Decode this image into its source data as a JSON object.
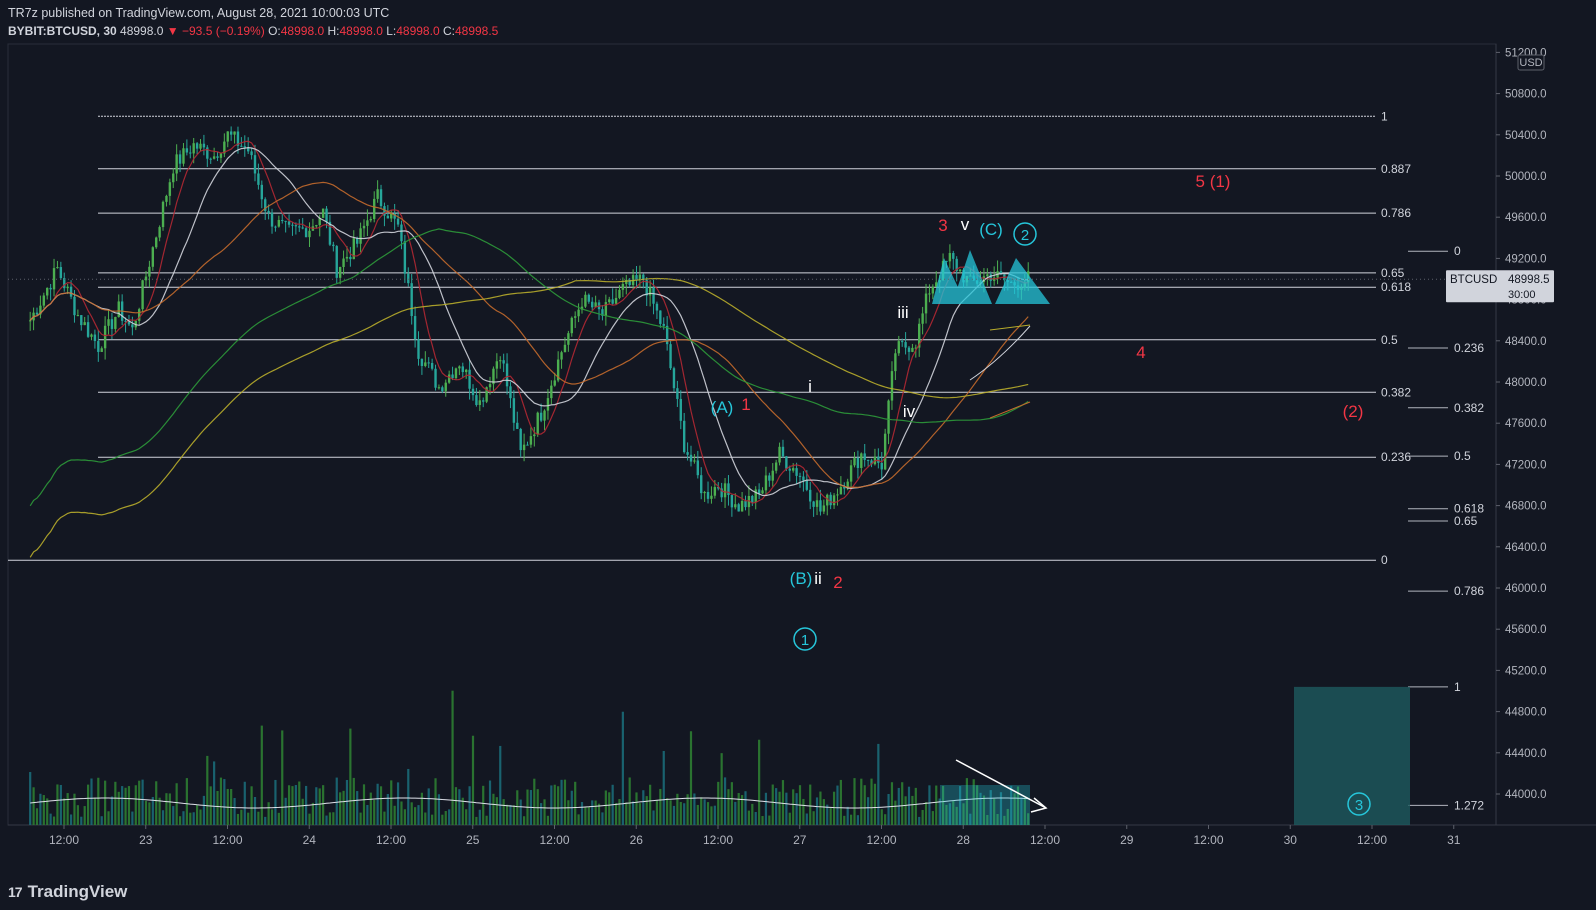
{
  "header": {
    "publisher": "TR7z published on TradingView.com, August 28, 2021 10:00:03 UTC",
    "symbol": "BYBIT:BTCUSD, 30",
    "last": "48998.0",
    "change": "−93.5 (−0.19%)",
    "o_label": "O:",
    "o": "48998.0",
    "h_label": "H:",
    "h": "48998.0",
    "l_label": "L:",
    "l": "48998.0",
    "c_label": "C:",
    "c": "48998.5"
  },
  "footer": {
    "brand": "TradingView",
    "logo": "17"
  },
  "colors": {
    "bg": "#131722",
    "grid": "#1e222d",
    "text": "#b2b5be",
    "up": "#4caf50",
    "down": "#26a69a",
    "red": "#f23645",
    "cyan": "#26c6da",
    "white": "#ffffff"
  },
  "chart_data": {
    "type": "candlestick",
    "symbol": "BTCUSD",
    "currency": "USD",
    "price_label": "48998.5",
    "price_sublabel": "30:00",
    "y_ticks": [
      51200,
      50800,
      50400,
      50000,
      49600,
      49200,
      48800,
      48400,
      48000,
      47600,
      47200,
      46800,
      46400,
      46000,
      45600,
      45200,
      44800,
      44400,
      44000
    ],
    "y_tick_labels": [
      "51200.0",
      "50800.0",
      "50400.0",
      "50000.0",
      "49600.0",
      "49200.0",
      "48800.0",
      "48400.0",
      "48000.0",
      "47600.0",
      "47200.0",
      "46800.0",
      "46400.0",
      "46000.0",
      "45600.0",
      "45200.0",
      "44800.0",
      "44400.0",
      "44000.0"
    ],
    "ylim": [
      43700,
      51250
    ],
    "x_ticks": [
      "12:00",
      "23",
      "12:00",
      "24",
      "12:00",
      "25",
      "12:00",
      "26",
      "12:00",
      "27",
      "12:00",
      "28",
      "12:00",
      "29",
      "12:00",
      "30",
      "12:00",
      "31"
    ],
    "price_path": [
      [
        "Aug 22 07:00",
        48600
      ],
      [
        "Aug 22 11:00",
        49100
      ],
      [
        "Aug 22 14:00",
        48650
      ],
      [
        "Aug 22 17:00",
        48350
      ],
      [
        "Aug 22 20:00",
        48700
      ],
      [
        "Aug 22 22:00",
        48500
      ],
      [
        "Aug 23 01:00",
        49300
      ],
      [
        "Aug 23 04:00",
        50100
      ],
      [
        "Aug 23 07:00",
        50300
      ],
      [
        "Aug 23 10:00",
        50200
      ],
      [
        "Aug 23 12:00",
        50400
      ],
      [
        "Aug 23 15:00",
        50250
      ],
      [
        "Aug 23 18:00",
        49600
      ],
      [
        "Aug 23 21:00",
        49450
      ],
      [
        "Aug 24 00:00",
        49500
      ],
      [
        "Aug 24 02:00",
        49650
      ],
      [
        "Aug 24 04:00",
        49100
      ],
      [
        "Aug 24 07:00",
        49350
      ],
      [
        "Aug 24 10:00",
        49800
      ],
      [
        "Aug 24 13:00",
        49500
      ],
      [
        "Aug 24 16:00",
        48300
      ],
      [
        "Aug 24 19:00",
        47950
      ],
      [
        "Aug 24 22:00",
        48200
      ],
      [
        "Aug 25 01:00",
        47800
      ],
      [
        "Aug 25 04:00",
        48300
      ],
      [
        "Aug 25 07:00",
        47300
      ],
      [
        "Aug 25 10:00",
        47700
      ],
      [
        "Aug 25 13:00",
        48300
      ],
      [
        "Aug 25 16:00",
        48800
      ],
      [
        "Aug 25 19:00",
        48650
      ],
      [
        "Aug 25 22:00",
        48900
      ],
      [
        "Aug 26 01:00",
        49000
      ],
      [
        "Aug 26 04:00",
        48500
      ],
      [
        "Aug 26 07:00",
        47400
      ],
      [
        "Aug 26 10:00",
        46900
      ],
      [
        "Aug 26 12:00",
        47000
      ],
      [
        "Aug 26 15:00",
        46800
      ],
      [
        "Aug 26 18:00",
        46900
      ],
      [
        "Aug 26 21:00",
        47300
      ],
      [
        "Aug 27 00:00",
        47100
      ],
      [
        "Aug 27 03:00",
        46750
      ],
      [
        "Aug 27 06:00",
        47000
      ],
      [
        "Aug 27 09:00",
        47300
      ],
      [
        "Aug 27 12:00",
        47200
      ],
      [
        "Aug 27 14:00",
        48300
      ],
      [
        "Aug 27 17:00",
        48400
      ],
      [
        "Aug 27 19:00",
        48900
      ],
      [
        "Aug 27 22:00",
        49200
      ],
      [
        "Aug 28 01:00",
        48950
      ],
      [
        "Aug 28 04:00",
        49050
      ],
      [
        "Aug 28 07:00",
        48950
      ],
      [
        "Aug 28 09:30",
        48998
      ]
    ],
    "fib_retracement": {
      "levels": [
        1,
        0.887,
        0.786,
        0.65,
        0.618,
        0.5,
        0.382,
        0.236,
        0
      ],
      "labels": [
        "1",
        "0.887",
        "0.786",
        "0.65",
        "0.618",
        "0.5",
        "0.382",
        "0.236",
        "0"
      ],
      "prices": [
        50580,
        50070,
        49640,
        49060,
        48920,
        48410,
        47900,
        47270,
        46270
      ]
    },
    "fib_extension": {
      "levels": [
        0,
        0.236,
        0.382,
        0.5,
        0.618,
        0.65,
        0.786,
        1,
        1.272
      ],
      "labels": [
        "0",
        "0.236",
        "0.382",
        "0.5",
        "0.618",
        "0.65",
        "0.786",
        "1",
        "1.272"
      ],
      "prices": [
        49270,
        48330,
        47750,
        47280,
        46770,
        46650,
        45970,
        45040,
        43890
      ]
    },
    "wave_labels": [
      {
        "text": "(A)",
        "color": "cyan"
      },
      {
        "text": "1",
        "color": "red"
      },
      {
        "text": "(B)",
        "color": "cyan"
      },
      {
        "text": "ii",
        "color": "white"
      },
      {
        "text": "2",
        "color": "red"
      },
      {
        "text": "i",
        "color": "white"
      },
      {
        "text": "iii",
        "color": "white"
      },
      {
        "text": "iv",
        "color": "white"
      },
      {
        "text": "3",
        "color": "red"
      },
      {
        "text": "v",
        "color": "white"
      },
      {
        "text": "(C)",
        "color": "cyan"
      },
      {
        "text": "2",
        "color": "cyan",
        "circled": true
      },
      {
        "text": "1",
        "color": "cyan",
        "circled": true
      },
      {
        "text": "4",
        "color": "red"
      },
      {
        "text": "5 (1)",
        "color": "red"
      },
      {
        "text": "(2)",
        "color": "red"
      },
      {
        "text": "3",
        "color": "cyan",
        "circled": true
      }
    ],
    "moving_averages": [
      "red",
      "white",
      "orange",
      "green",
      "yellow"
    ],
    "volume": {
      "shown": true,
      "trend": "decreasing"
    }
  }
}
